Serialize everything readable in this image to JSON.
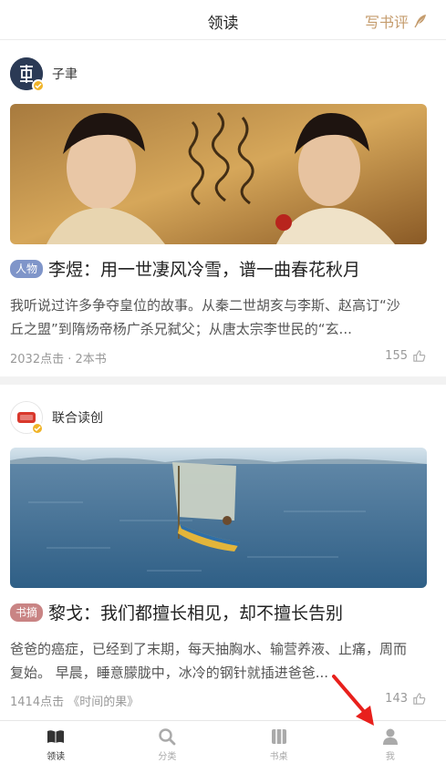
{
  "header": {
    "title": "领读",
    "write_review": "写书评"
  },
  "posts": [
    {
      "author": "子聿",
      "tag": "人物",
      "headline": "李煜：用一世凄风冷雪，谱一曲春花秋月",
      "summary": "我听说过许多争夺皇位的故事。从秦二世胡亥与李斯、赵高订“沙丘之盟”到隋炀帝杨广杀兄弑父；从唐太宗李世民的“玄...",
      "meta": "2032点击 · 2本书",
      "likes": "155"
    },
    {
      "author": "联合读创",
      "tag": "书摘",
      "headline": "黎戈：我们都擅长相见，却不擅长告别",
      "summary": " 爸爸的癌症，已经到了末期，每天抽胸水、输营养液、止痛，周而复始。 早晨，睡意朦胧中，冰冷的钢针就插进爸爸...",
      "meta": "1414点击 《时间的果》",
      "likes": "143"
    }
  ],
  "nav": [
    {
      "label": "领读",
      "icon": "book-open-icon",
      "active": true
    },
    {
      "label": "分类",
      "icon": "search-icon",
      "active": false
    },
    {
      "label": "书桌",
      "icon": "bookshelf-icon",
      "active": false
    },
    {
      "label": "我",
      "icon": "person-icon",
      "active": false
    }
  ],
  "colors": {
    "accent": "#c49b6c",
    "tag_person": "#7f95c9",
    "tag_excerpt": "#c98484",
    "annotation_arrow": "#e8201c"
  }
}
